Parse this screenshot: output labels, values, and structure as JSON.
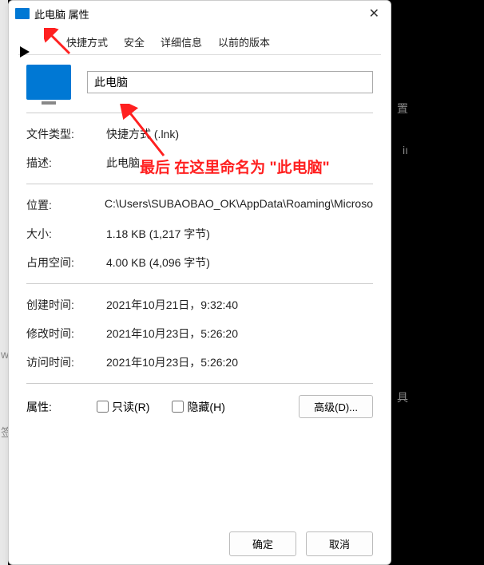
{
  "window": {
    "title": "此电脑 属性"
  },
  "tabs": {
    "shortcut": "快捷方式",
    "security": "安全",
    "details": "详细信息",
    "previous": "以前的版本"
  },
  "name_field": {
    "value": "此电脑"
  },
  "fields": {
    "file_type": {
      "label": "文件类型:",
      "value": "快捷方式 (.lnk)"
    },
    "description": {
      "label": "描述:",
      "value": "此电脑"
    },
    "location": {
      "label": "位置:",
      "value": "C:\\Users\\SUBAOBAO_OK\\AppData\\Roaming\\Microso"
    },
    "size": {
      "label": "大小:",
      "value": "1.18 KB (1,217 字节)"
    },
    "size_on_disk": {
      "label": "占用空间:",
      "value": "4.00 KB (4,096 字节)"
    },
    "created": {
      "label": "创建时间:",
      "value": "2021年10月21日，9:32:40"
    },
    "modified": {
      "label": "修改时间:",
      "value": "2021年10月23日，5:26:20"
    },
    "accessed": {
      "label": "访问时间:",
      "value": "2021年10月23日，5:26:20"
    }
  },
  "attributes": {
    "label": "属性:",
    "readonly": "只读(R)",
    "hidden": "隐藏(H)",
    "advanced": "高级(D)..."
  },
  "buttons": {
    "ok": "确定",
    "cancel": "取消"
  },
  "annotation": "最后 在这里命名为 \"此电脑\"",
  "bg": {
    "w": "w",
    "q": "签",
    "r1": "置",
    "r2": "iı",
    "r3": "具"
  }
}
